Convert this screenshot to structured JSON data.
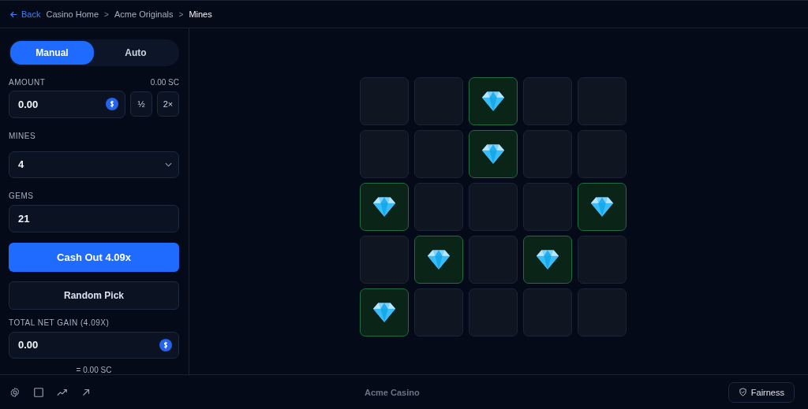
{
  "breadcrumb": {
    "back": "Back",
    "items": [
      {
        "label": "Casino Home",
        "current": false
      },
      {
        "label": "Acme Originals",
        "current": false
      },
      {
        "label": "Mines",
        "current": true
      }
    ],
    "separator": ">"
  },
  "mode_tabs": [
    {
      "label": "Manual",
      "selected": true
    },
    {
      "label": "Auto",
      "selected": false
    }
  ],
  "amount": {
    "label": "AMOUNT",
    "balance": "0.00 SC",
    "value": "0.00",
    "half": "½",
    "double": "2×"
  },
  "mines": {
    "label": "MINES",
    "value": "4"
  },
  "gems": {
    "label": "GEMS",
    "value": "21"
  },
  "cash_out": "Cash Out 4.09x",
  "random_pick": "Random Pick",
  "net_gain": {
    "label": "TOTAL NET GAIN (4.09X)",
    "value": "0.00",
    "conversion": "= 0.00 SC"
  },
  "tiles": [
    {
      "revealed": false
    },
    {
      "revealed": false
    },
    {
      "revealed": true
    },
    {
      "revealed": false
    },
    {
      "revealed": false
    },
    {
      "revealed": false
    },
    {
      "revealed": false
    },
    {
      "revealed": true
    },
    {
      "revealed": false
    },
    {
      "revealed": false
    },
    {
      "revealed": true
    },
    {
      "revealed": false
    },
    {
      "revealed": false
    },
    {
      "revealed": false
    },
    {
      "revealed": true
    },
    {
      "revealed": false
    },
    {
      "revealed": true
    },
    {
      "revealed": false
    },
    {
      "revealed": true
    },
    {
      "revealed": false
    },
    {
      "revealed": true
    },
    {
      "revealed": false
    },
    {
      "revealed": false
    },
    {
      "revealed": false
    },
    {
      "revealed": false
    }
  ],
  "footer": {
    "brand": "Acme Casino",
    "fairness": "Fairness"
  }
}
